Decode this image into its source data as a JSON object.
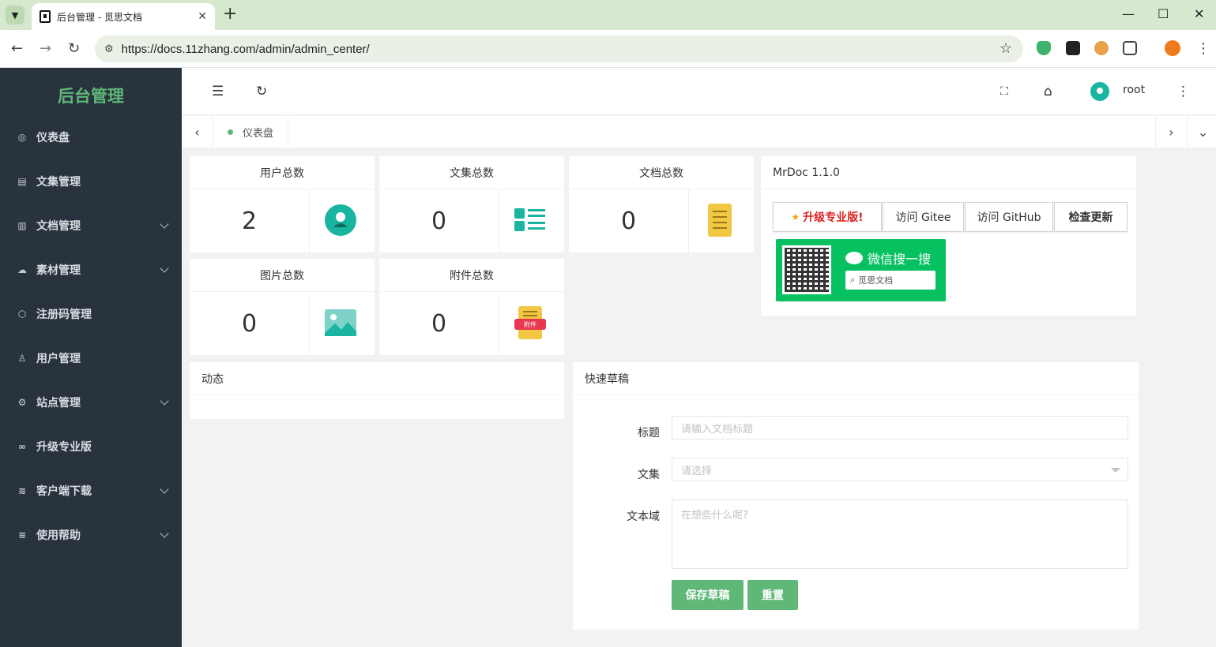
{
  "browser": {
    "tab_title": "后台管理 - 觅思文档",
    "tab_close": "✕",
    "new_tab": "+",
    "url": "https://docs.11zhang.com/admin/admin_center/",
    "win_min": "—",
    "win_max": "☐",
    "win_close": "✕"
  },
  "sidebar": {
    "logo": "后台管理",
    "items": [
      {
        "label": "仪表盘",
        "icon": "dashboard-icon",
        "glyph": "◎",
        "expandable": false
      },
      {
        "label": "文集管理",
        "icon": "collection-icon",
        "glyph": "▤",
        "expandable": false
      },
      {
        "label": "文档管理",
        "icon": "document-icon",
        "glyph": "▥",
        "expandable": true
      },
      {
        "label": "素材管理",
        "icon": "cloud-icon",
        "glyph": "☁",
        "expandable": true
      },
      {
        "label": "注册码管理",
        "icon": "cube-icon",
        "glyph": "⬡",
        "expandable": false
      },
      {
        "label": "用户管理",
        "icon": "user-icon",
        "glyph": "♙",
        "expandable": false
      },
      {
        "label": "站点管理",
        "icon": "gear-icon",
        "glyph": "⚙",
        "expandable": true
      },
      {
        "label": "升级专业版",
        "icon": "infinity-icon",
        "glyph": "∞",
        "expandable": false
      },
      {
        "label": "客户端下载",
        "icon": "layers-icon",
        "glyph": "≋",
        "expandable": true
      },
      {
        "label": "使用帮助",
        "icon": "help-layers-icon",
        "glyph": "≋",
        "expandable": true
      }
    ]
  },
  "header": {
    "username": "root"
  },
  "page_tabs": {
    "active": "仪表盘"
  },
  "stats": [
    {
      "title": "用户总数",
      "value": "2",
      "icon": "user-circle-icon"
    },
    {
      "title": "文集总数",
      "value": "0",
      "icon": "list-icon"
    },
    {
      "title": "文档总数",
      "value": "0",
      "icon": "doc-lines-icon"
    },
    {
      "title": "图片总数",
      "value": "0",
      "icon": "image-icon"
    },
    {
      "title": "附件总数",
      "value": "0",
      "icon": "attachment-icon",
      "badge": "附件"
    }
  ],
  "version_card": {
    "title": "MrDoc 1.1.0",
    "buttons": [
      "升级专业版!",
      "访问 Gitee",
      "访问 GitHub",
      "检查更新"
    ],
    "star": "★",
    "wechat_title": "微信搜一搜",
    "wechat_search": "觅思文档"
  },
  "activity_card": {
    "title": "动态"
  },
  "draft_card": {
    "title": "快速草稿",
    "title_label": "标题",
    "title_placeholder": "请输入文档标题",
    "collection_label": "文集",
    "collection_placeholder": "请选择",
    "text_label": "文本域",
    "text_placeholder": "在想些什么呢?",
    "save_button": "保存草稿",
    "reset_button": "重置"
  },
  "colors": {
    "sidebar_bg": "#28333e",
    "accent_green": "#5fb878",
    "teal": "#19b5a0",
    "yellow": "#f2c744",
    "wechat_green": "#07c160"
  }
}
